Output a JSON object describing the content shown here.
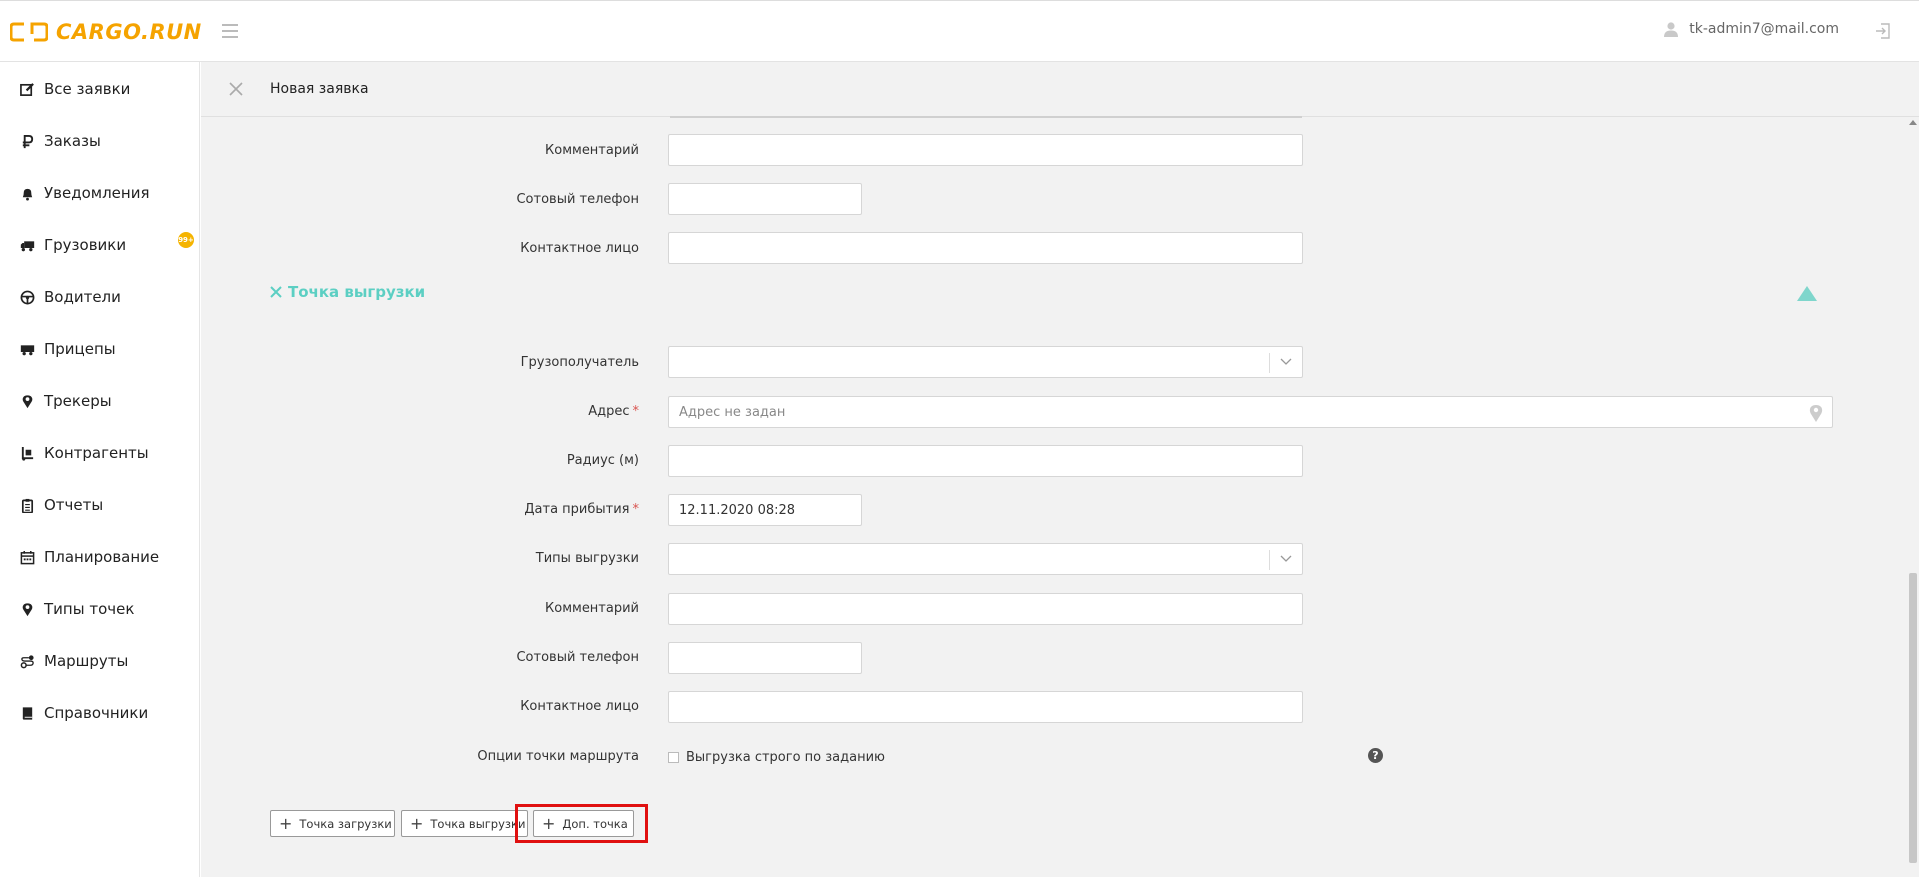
{
  "header": {
    "brand": "CARGO.RUN",
    "user_email": "tk-admin7@mail.com"
  },
  "sidebar": {
    "items": [
      {
        "label": "Все заявки",
        "icon": "edit-icon"
      },
      {
        "label": "Заказы",
        "icon": "ruble-icon"
      },
      {
        "label": "Уведомления",
        "icon": "bell-icon"
      },
      {
        "label": "Грузовики",
        "icon": "truck-icon"
      },
      {
        "label": "Водители",
        "icon": "steering-wheel-icon"
      },
      {
        "label": "Прицепы",
        "icon": "trailer-icon"
      },
      {
        "label": "Трекеры",
        "icon": "map-pin-icon"
      },
      {
        "label": "Контрагенты",
        "icon": "hand-truck-icon"
      },
      {
        "label": "Отчеты",
        "icon": "clipboard-icon"
      },
      {
        "label": "Планирование",
        "icon": "calendar-icon"
      },
      {
        "label": "Типы точек",
        "icon": "map-pin-icon"
      },
      {
        "label": "Маршруты",
        "icon": "route-icon"
      },
      {
        "label": "Справочники",
        "icon": "book-icon"
      }
    ],
    "notifications_badge": "99+"
  },
  "tab": {
    "title": "Новая заявка"
  },
  "form": {
    "upper": {
      "comment_label": "Комментарий",
      "phone_label": "Сотовый телефон",
      "contact_label": "Контактное лицо"
    },
    "unloading": {
      "section_title": "Точка выгрузки",
      "consignee_label": "Грузополучатель",
      "address_label": "Адрес",
      "address_placeholder": "Адрес не задан",
      "radius_label": "Радиус (м)",
      "arrival_label": "Дата прибытия",
      "arrival_value": "12.11.2020 08:28",
      "unload_types_label": "Типы выгрузки",
      "comment_label": "Комментарий",
      "phone_label": "Сотовый телефон",
      "contact_label": "Контактное лицо",
      "route_options_label": "Опции точки маршрута",
      "strict_unload_label": "Выгрузка строго по заданию",
      "required_mark": "*"
    },
    "buttons": {
      "add_loading": "Точка загрузки",
      "add_unloading": "Точка выгрузки",
      "add_extra": "Доп. точка"
    }
  },
  "colors": {
    "brand": "#f5a300",
    "accent": "#5ccfc3",
    "highlight": "#e01010"
  }
}
